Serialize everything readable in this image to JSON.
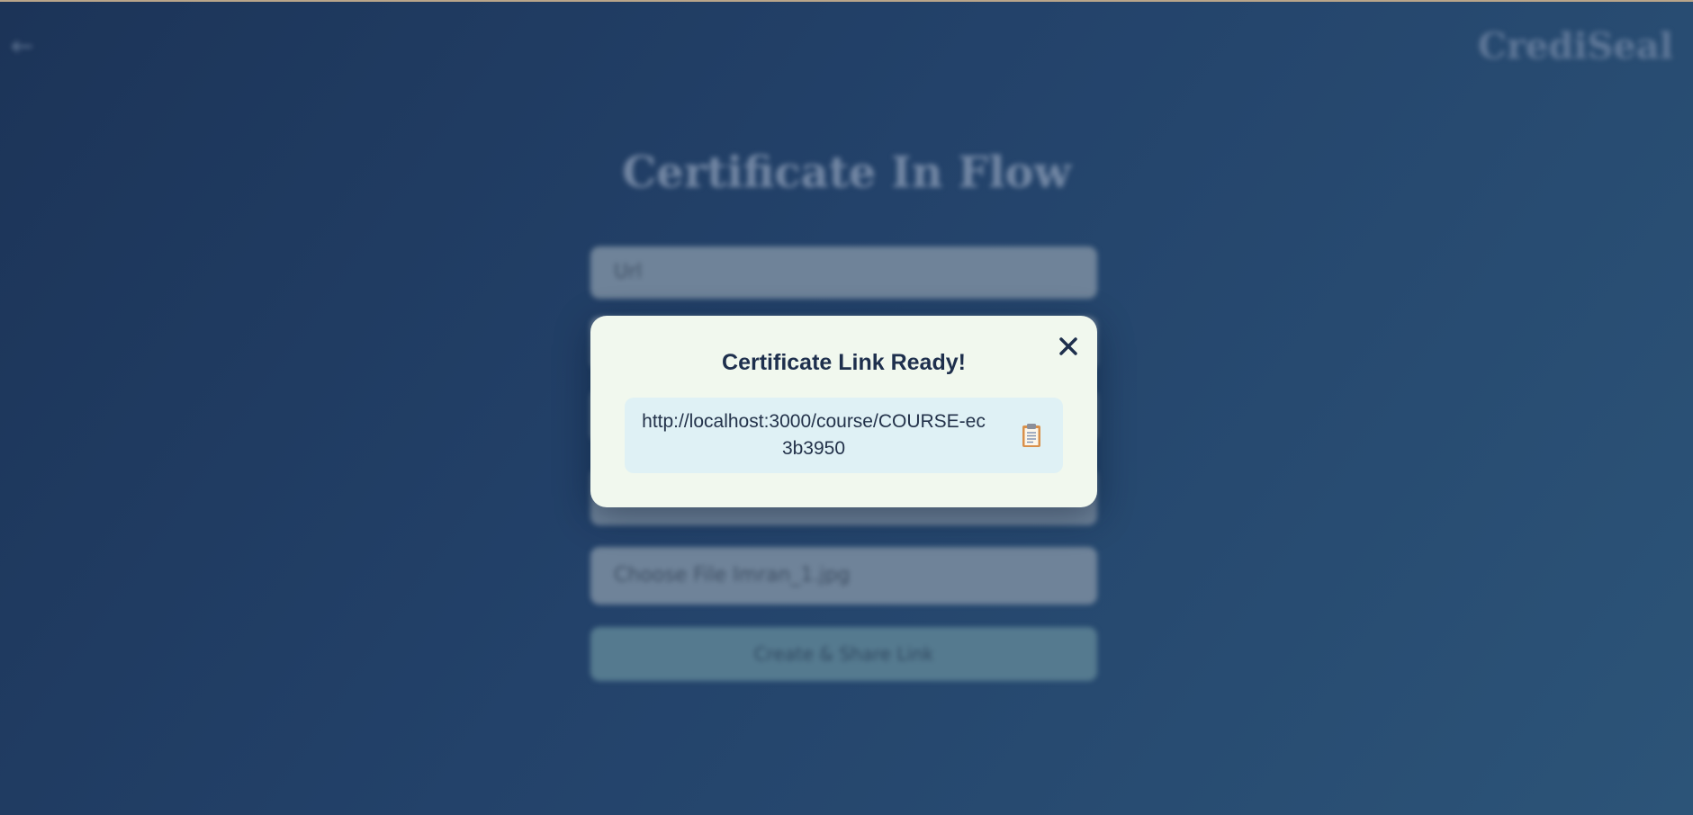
{
  "app": {
    "brand": "CrediSeal",
    "back_arrow": "←"
  },
  "form": {
    "title": "Certificate In Flow",
    "url_placeholder": "Url",
    "file_label": "Choose File  Imran_1.jpg",
    "submit_label": "Create & Share Link"
  },
  "modal": {
    "title": "Certificate Link Ready!",
    "link": "http://localhost:3000/course/COURSE-ec3b3950",
    "close_icon": "close-icon",
    "copy_icon": "clipboard-icon"
  },
  "colors": {
    "background": "#23426a",
    "modal_bg": "#f1f8ee",
    "link_box_bg": "#dff1f5",
    "title_text": "#1e2f4d"
  }
}
